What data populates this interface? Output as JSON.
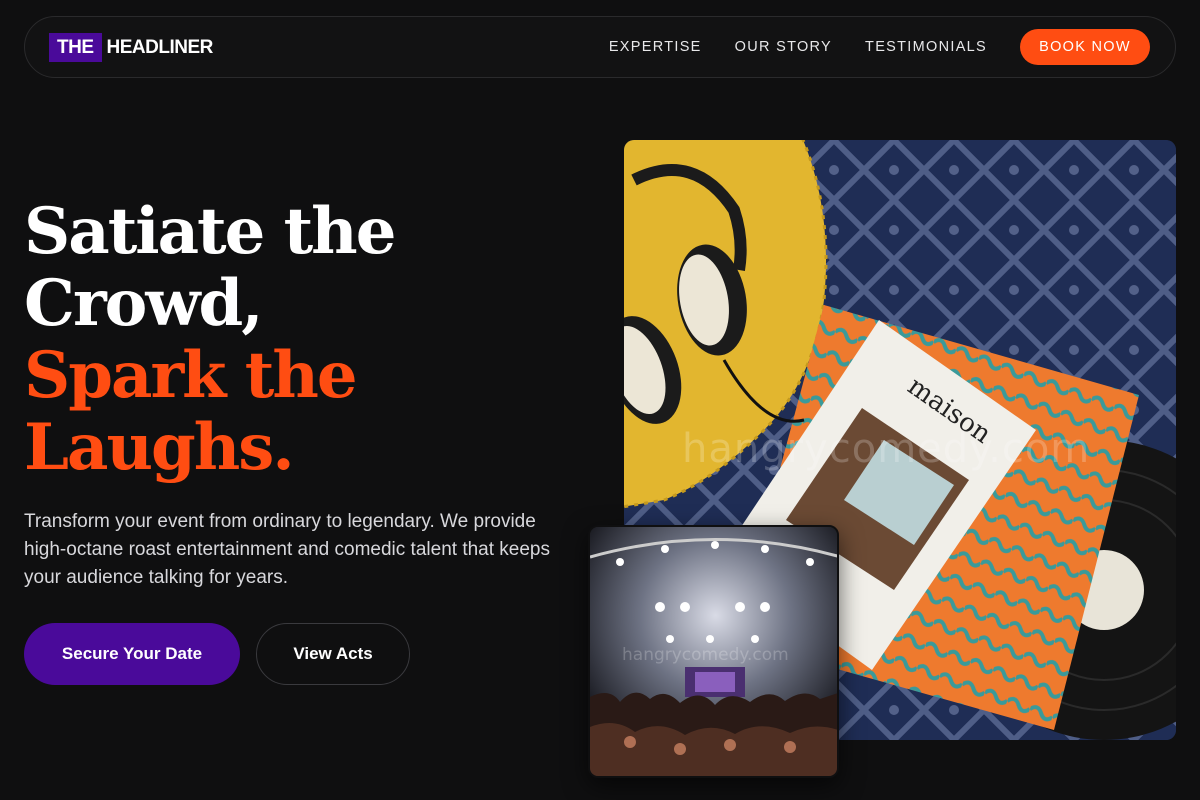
{
  "brand": {
    "badge": "THE",
    "name": "HEADLINER"
  },
  "nav": {
    "links": [
      "EXPERTISE",
      "OUR STORY",
      "TESTIMONIALS"
    ],
    "cta": "BOOK NOW"
  },
  "hero": {
    "headline_white": [
      "Satiate the",
      "Crowd,"
    ],
    "headline_orange": [
      "Spark the",
      "Laughs."
    ],
    "subtext": "Transform your event from ordinary to legendary. We provide high-octane roast entertainment and comedic talent that keeps your audience talking for years.",
    "primary_button": "Secure Your Date",
    "secondary_button": "View Acts"
  },
  "images": {
    "main_magazine_title": "maison",
    "watermark": "hangrycomedy.com"
  },
  "colors": {
    "accent_orange": "#ff4d12",
    "brand_purple": "#4a0a9a",
    "background": "#0f0f10"
  }
}
